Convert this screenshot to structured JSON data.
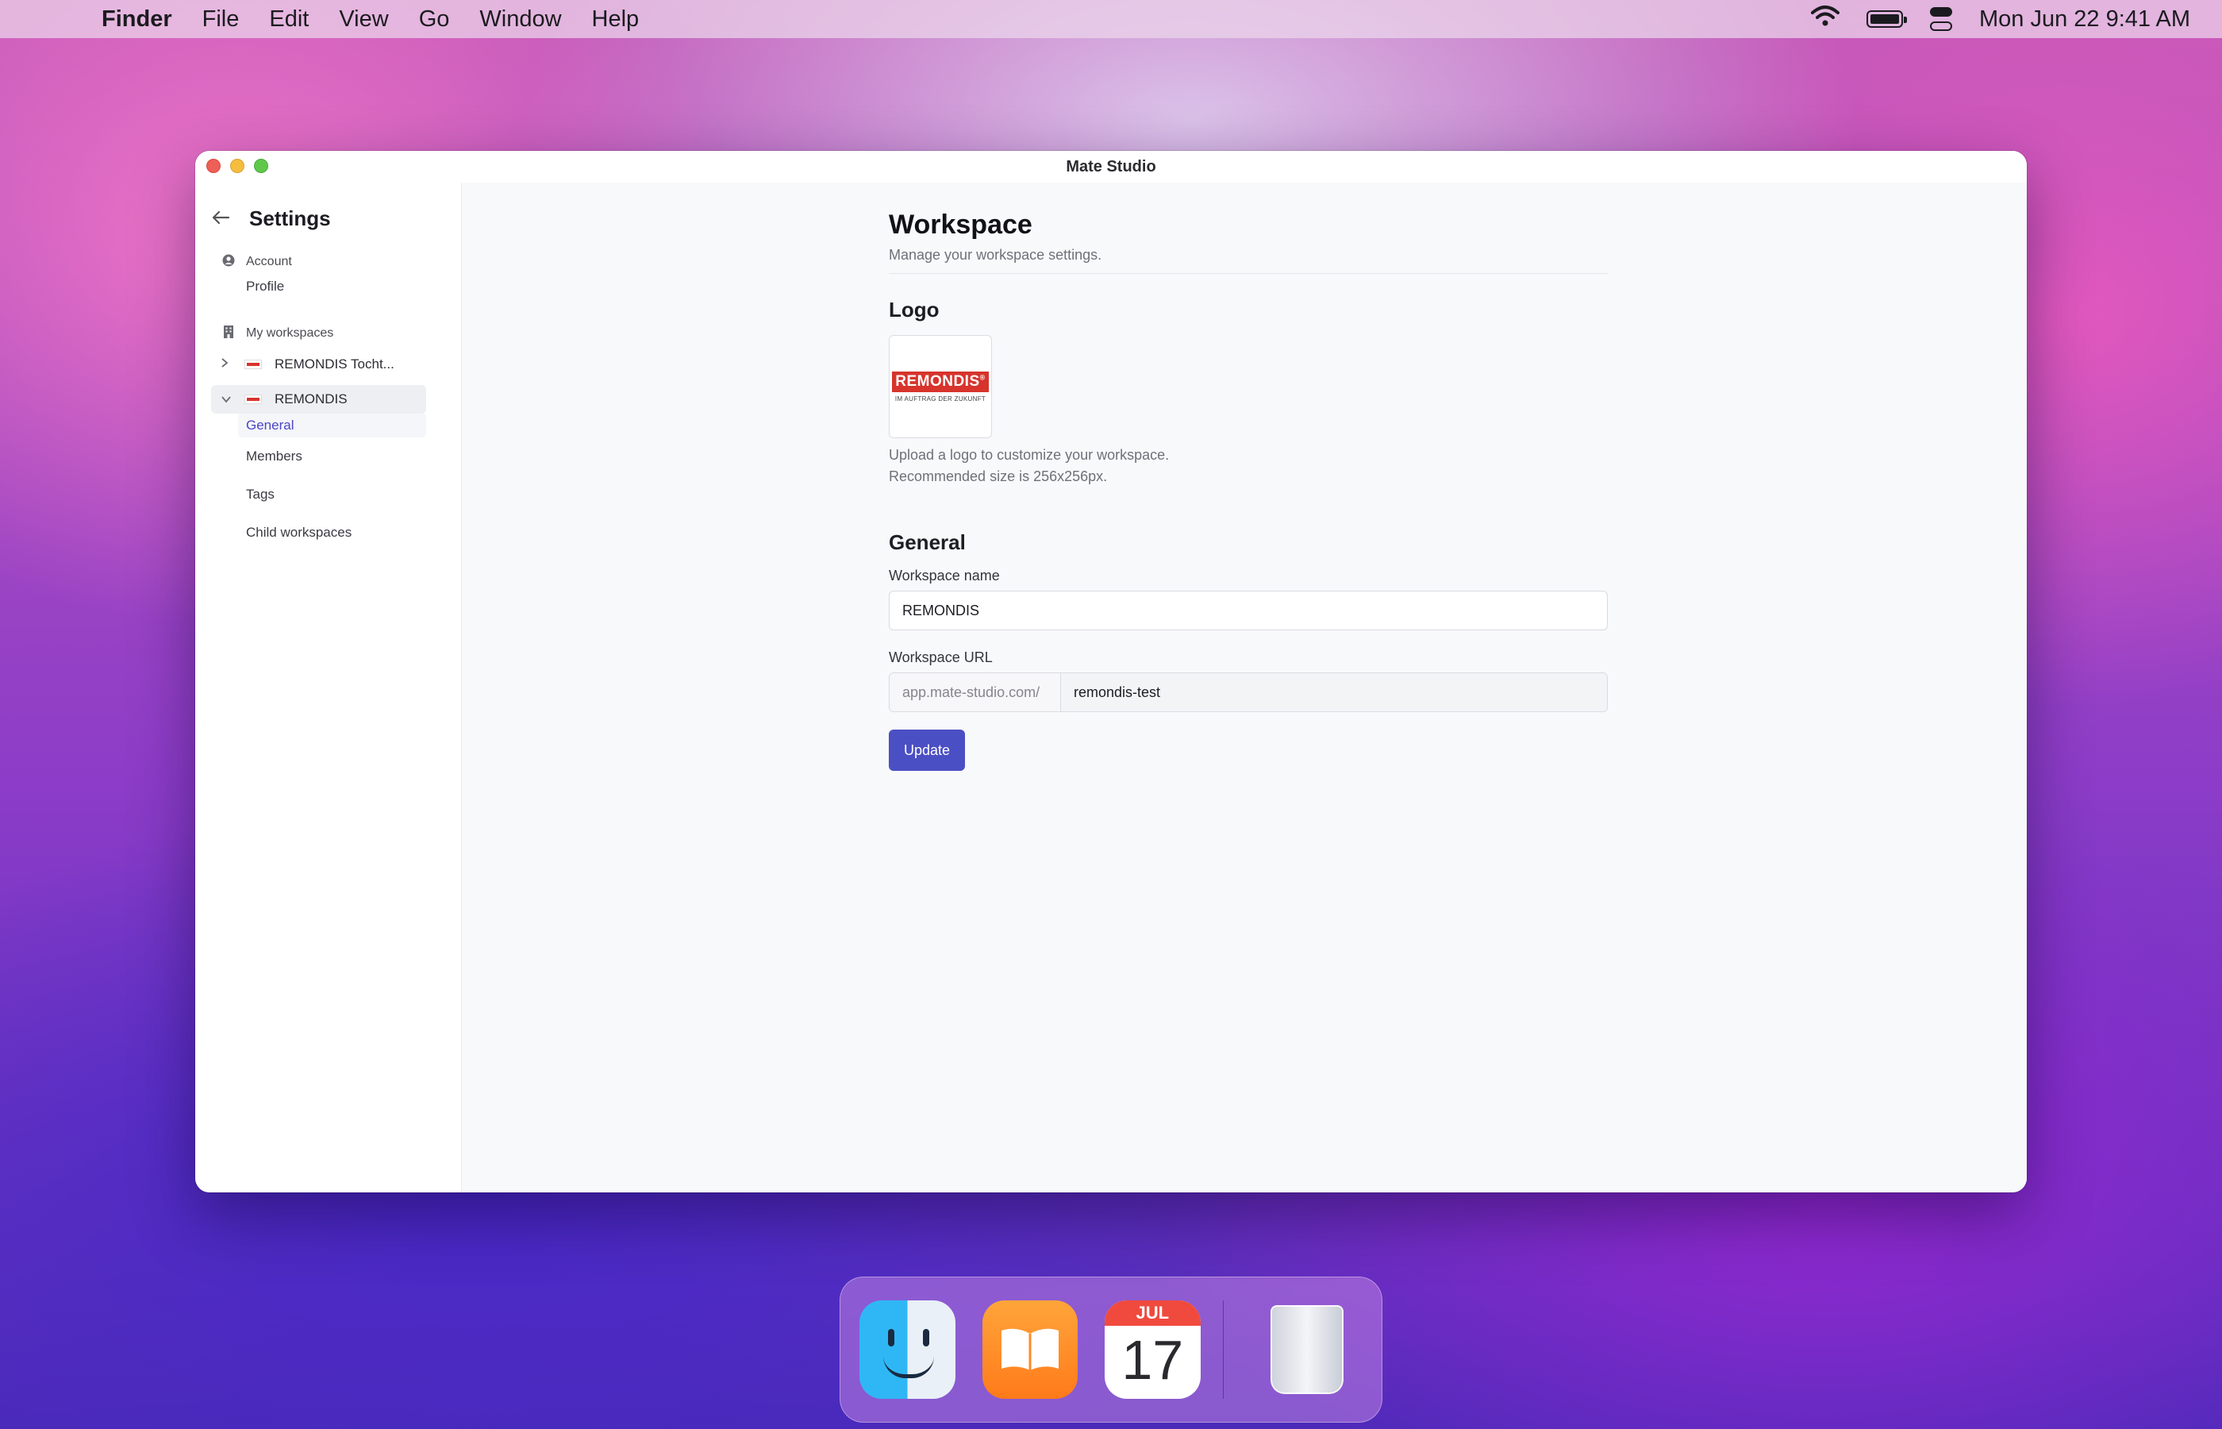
{
  "menubar": {
    "app_name": "Finder",
    "menus": [
      "File",
      "Edit",
      "View",
      "Go",
      "Window",
      "Help"
    ],
    "clock": "Mon Jun 22  9:41 AM"
  },
  "window": {
    "title": "Mate Studio"
  },
  "sidebar": {
    "title": "Settings",
    "account_label": "Account",
    "account_items": [
      "Profile"
    ],
    "workspaces_label": "My workspaces",
    "workspaces": [
      {
        "name": "REMONDIS Tocht...",
        "expanded": false
      },
      {
        "name": "REMONDIS",
        "expanded": true
      }
    ],
    "workspace_items": [
      "General",
      "Members",
      "Tags",
      "Child workspaces"
    ],
    "active_item": "General"
  },
  "main": {
    "title": "Workspace",
    "subtitle": "Manage your workspace settings.",
    "logo_heading": "Logo",
    "logo_brand": "REMONDIS",
    "logo_trademark": "®",
    "logo_tagline": "IM AUFTRAG DER ZUKUNFT",
    "logo_hint_1": "Upload a logo to customize your workspace.",
    "logo_hint_2": "Recommended size is 256x256px.",
    "general_heading": "General",
    "name_label": "Workspace name",
    "name_value": "REMONDIS",
    "url_label": "Workspace URL",
    "url_prefix": "app.mate-studio.com/",
    "url_value": "remondis-test",
    "update_button": "Update"
  },
  "dock": {
    "calendar_month": "JUL",
    "calendar_day": "17"
  },
  "colors": {
    "accent": "#4b4fc4",
    "brand_red": "#d6342c"
  }
}
